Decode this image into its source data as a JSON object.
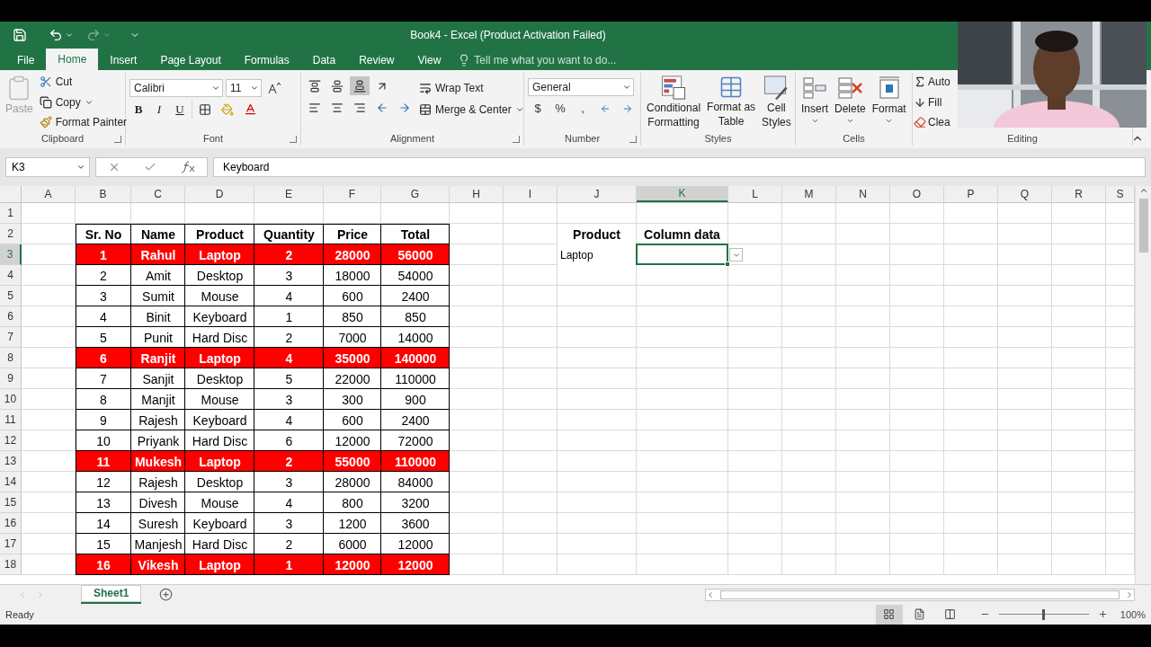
{
  "title_bar": {
    "title": "Book4 - Excel (Product Activation Failed)"
  },
  "tabs": [
    {
      "label": "File",
      "selected": false
    },
    {
      "label": "Home",
      "selected": true
    },
    {
      "label": "Insert",
      "selected": false
    },
    {
      "label": "Page Layout",
      "selected": false
    },
    {
      "label": "Formulas",
      "selected": false
    },
    {
      "label": "Data",
      "selected": false
    },
    {
      "label": "Review",
      "selected": false
    },
    {
      "label": "View",
      "selected": false
    }
  ],
  "tell_me": {
    "placeholder": "Tell me what you want to do..."
  },
  "ribbon": {
    "clipboard": {
      "label": "Clipboard",
      "paste": {
        "label": "Paste",
        "disabled": true
      },
      "cut": "Cut",
      "copy": "Copy",
      "format_painter": "Format Painter"
    },
    "font": {
      "label": "Font",
      "font_name": "Calibri",
      "font_size": "11",
      "styles": [
        "B",
        "I",
        "U"
      ]
    },
    "alignment": {
      "label": "Alignment",
      "vertical_align": [
        {
          "selected": false
        },
        {
          "selected": false
        },
        {
          "selected": true
        }
      ],
      "wrap_text": "Wrap Text",
      "merge_center": "Merge & Center"
    },
    "number": {
      "label": "Number",
      "format": "General",
      "symbols": [
        "$",
        "%",
        ","
      ]
    },
    "styles": {
      "label": "Styles",
      "buttons": [
        {
          "lines": [
            "Conditional",
            "Formatting"
          ]
        },
        {
          "lines": [
            "Format as",
            "Table"
          ]
        },
        {
          "lines": [
            "Cell",
            "Styles"
          ]
        }
      ]
    },
    "cells": {
      "label": "Cells",
      "buttons": [
        "Insert",
        "Delete",
        "Format"
      ]
    },
    "editing": {
      "label": "Editing",
      "buttons": [
        "Auto",
        "Fill",
        "Clea"
      ]
    }
  },
  "formula_bar": {
    "name_box": "K3",
    "value": "Keyboard"
  },
  "sheet": {
    "column_headers": [
      {
        "label": "A",
        "selected": false
      },
      {
        "label": "B",
        "selected": false
      },
      {
        "label": "C",
        "selected": false
      },
      {
        "label": "D",
        "selected": false
      },
      {
        "label": "E",
        "selected": false
      },
      {
        "label": "F",
        "selected": false
      },
      {
        "label": "G",
        "selected": false
      },
      {
        "label": "H",
        "selected": false
      },
      {
        "label": "I",
        "selected": false
      },
      {
        "label": "J",
        "selected": false
      },
      {
        "label": "K",
        "selected": true
      },
      {
        "label": "L",
        "selected": false
      },
      {
        "label": "M",
        "selected": false
      },
      {
        "label": "N",
        "selected": false
      },
      {
        "label": "O",
        "selected": false
      },
      {
        "label": "P",
        "selected": false
      },
      {
        "label": "Q",
        "selected": false
      },
      {
        "label": "R",
        "selected": false
      },
      {
        "label": "S",
        "selected": false
      }
    ],
    "row_headers": [
      {
        "label": "1",
        "selected": false
      },
      {
        "label": "2",
        "selected": false
      },
      {
        "label": "3",
        "selected": true
      },
      {
        "label": "4",
        "selected": false
      },
      {
        "label": "5",
        "selected": false
      },
      {
        "label": "6",
        "selected": false
      },
      {
        "label": "7",
        "selected": false
      },
      {
        "label": "8",
        "selected": false
      },
      {
        "label": "9",
        "selected": false
      },
      {
        "label": "10",
        "selected": false
      },
      {
        "label": "11",
        "selected": false
      },
      {
        "label": "12",
        "selected": false
      },
      {
        "label": "13",
        "selected": false
      },
      {
        "label": "14",
        "selected": false
      },
      {
        "label": "15",
        "selected": false
      },
      {
        "label": "16",
        "selected": false
      },
      {
        "label": "17",
        "selected": false
      },
      {
        "label": "18",
        "selected": false
      }
    ],
    "table": {
      "header": [
        "Sr. No",
        "Name",
        "Product",
        "Quantity",
        "Price",
        "Total"
      ],
      "rows": [
        {
          "highlighted": true,
          "cells": [
            "1",
            "Rahul",
            "Laptop",
            "2",
            "28000",
            "56000"
          ]
        },
        {
          "highlighted": false,
          "cells": [
            "2",
            "Amit",
            "Desktop",
            "3",
            "18000",
            "54000"
          ]
        },
        {
          "highlighted": false,
          "cells": [
            "3",
            "Sumit",
            "Mouse",
            "4",
            "600",
            "2400"
          ]
        },
        {
          "highlighted": false,
          "cells": [
            "4",
            "Binit",
            "Keyboard",
            "1",
            "850",
            "850"
          ]
        },
        {
          "highlighted": false,
          "cells": [
            "5",
            "Punit",
            "Hard Disc",
            "2",
            "7000",
            "14000"
          ]
        },
        {
          "highlighted": true,
          "cells": [
            "6",
            "Ranjit",
            "Laptop",
            "4",
            "35000",
            "140000"
          ]
        },
        {
          "highlighted": false,
          "cells": [
            "7",
            "Sanjit",
            "Desktop",
            "5",
            "22000",
            "110000"
          ]
        },
        {
          "highlighted": false,
          "cells": [
            "8",
            "Manjit",
            "Mouse",
            "3",
            "300",
            "900"
          ]
        },
        {
          "highlighted": false,
          "cells": [
            "9",
            "Rajesh",
            "Keyboard",
            "4",
            "600",
            "2400"
          ]
        },
        {
          "highlighted": false,
          "cells": [
            "10",
            "Priyank",
            "Hard Disc",
            "6",
            "12000",
            "72000"
          ]
        },
        {
          "highlighted": true,
          "cells": [
            "11",
            "Mukesh",
            "Laptop",
            "2",
            "55000",
            "110000"
          ]
        },
        {
          "highlighted": false,
          "cells": [
            "12",
            "Rajesh",
            "Desktop",
            "3",
            "28000",
            "84000"
          ]
        },
        {
          "highlighted": false,
          "cells": [
            "13",
            "Divesh",
            "Mouse",
            "4",
            "800",
            "3200"
          ]
        },
        {
          "highlighted": false,
          "cells": [
            "14",
            "Suresh",
            "Keyboard",
            "3",
            "1200",
            "3600"
          ]
        },
        {
          "highlighted": false,
          "cells": [
            "15",
            "Manjesh",
            "Hard Disc",
            "2",
            "6000",
            "12000"
          ]
        },
        {
          "highlighted": true,
          "cells": [
            "16",
            "Vikesh",
            "Laptop",
            "1",
            "12000",
            "12000"
          ]
        }
      ]
    },
    "lookup": {
      "headers": [
        "Product",
        "Column data"
      ],
      "value": "Laptop",
      "validation_dropdown": true
    }
  },
  "sheet_tabs": [
    {
      "label": "Sheet1",
      "selected": true
    }
  ],
  "status_bar": {
    "status": "Ready",
    "views": [
      {
        "selected": true
      },
      {
        "selected": false
      },
      {
        "selected": false
      }
    ],
    "zoom": {
      "level": 0.5,
      "reading": "100%"
    }
  }
}
